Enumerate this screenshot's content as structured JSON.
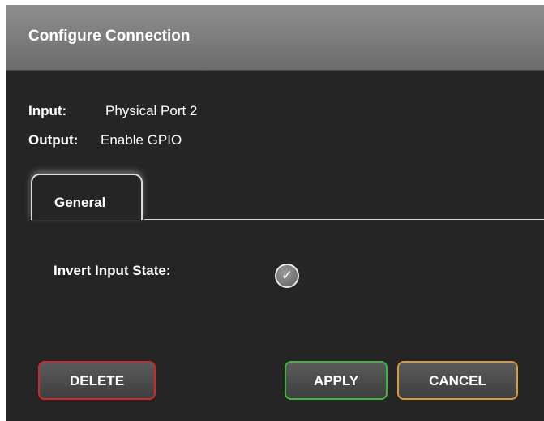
{
  "dialog": {
    "title": "Configure Connection"
  },
  "connection": {
    "input_label": "Input:",
    "input_value": "Physical Port 2",
    "output_label": "Output:",
    "output_value": "Enable GPIO"
  },
  "tabs": [
    {
      "label": "General",
      "active": true
    }
  ],
  "general": {
    "invert_label": "Invert Input State:",
    "invert_checked": true,
    "check_glyph": "✓"
  },
  "buttons": {
    "delete": "DELETE",
    "apply": "APPLY",
    "cancel": "CANCEL"
  },
  "colors": {
    "delete_border": "#cf2a2a",
    "apply_border": "#3fb43f",
    "cancel_border": "#d99a3a"
  },
  "icons": {
    "checkbox": "checkmark-circle-icon"
  }
}
